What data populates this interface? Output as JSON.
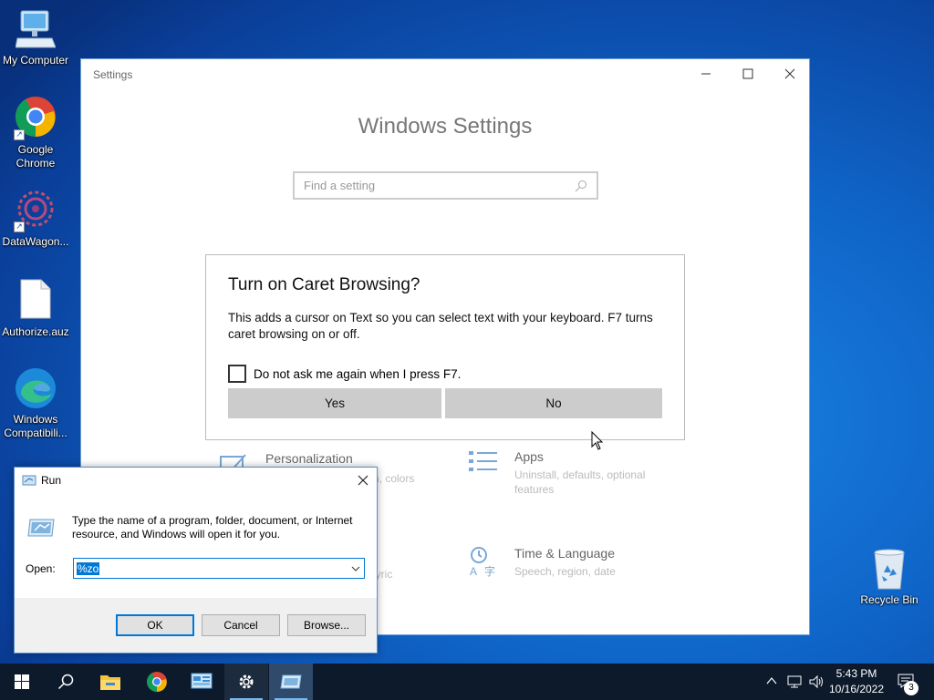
{
  "desktop": {
    "icons": [
      {
        "label": "My Computer"
      },
      {
        "label": "Google Chrome"
      },
      {
        "label": "DataWagon..."
      },
      {
        "label": "Authorize.auz"
      },
      {
        "label": "Windows Compatibili..."
      },
      {
        "label": "Recycle Bin"
      }
    ]
  },
  "settings": {
    "title": "Settings",
    "heading": "Windows Settings",
    "search_placeholder": "Find a setting",
    "tiles": [
      {
        "title": "Personalization",
        "subtitle": "Background, lock screen, colors",
        "icon": "personalization-icon"
      },
      {
        "title": "Apps",
        "subtitle": "Uninstall, defaults, optional features",
        "icon": "apps-icon"
      },
      {
        "title": "",
        "subtitle": "Lyric",
        "icon": "accounts-icon"
      },
      {
        "title": "Time & Language",
        "subtitle": "Speech, region, date",
        "icon": "time-language-icon"
      }
    ],
    "partial_texts": {
      "colors": "n, colors",
      "lyric": "lyric"
    }
  },
  "caret_dialog": {
    "title": "Turn on Caret Browsing?",
    "message": "This adds a cursor on Text so you can select text with your keyboard. F7 turns caret browsing on or off.",
    "checkbox_label": "Do not ask me again when I press F7.",
    "yes_label": "Yes",
    "no_label": "No"
  },
  "run_dialog": {
    "title": "Run",
    "description": "Type the name of a program, folder, document, or Internet resource, and Windows will open it for you.",
    "open_label": "Open:",
    "open_value": "%zo",
    "ok_label": "OK",
    "cancel_label": "Cancel",
    "browse_label": "Browse..."
  },
  "taskbar": {
    "time": "5:43 PM",
    "date": "10/16/2022",
    "notification_count": "3",
    "items": [
      "start-icon",
      "search-icon",
      "file-explorer-icon",
      "chrome-icon",
      "control-panel-icon",
      "settings-gear-icon",
      "run-icon"
    ],
    "colors": {
      "background": "#0c1a2c",
      "accent": "#76b9ed"
    }
  }
}
